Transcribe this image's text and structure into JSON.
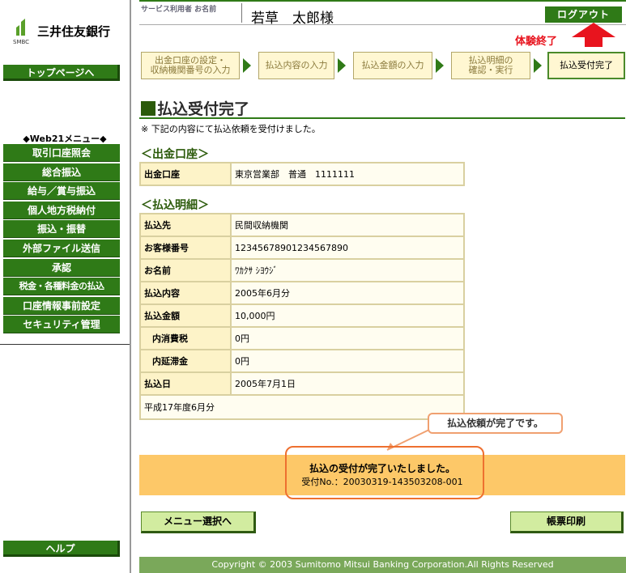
{
  "sidebar": {
    "brand_name": "三井住友銀行",
    "brand_sub": "SMBC",
    "top_page": "トップページへ",
    "menu_title": "◆Web21メニュー◆",
    "menu_items": [
      "取引口座照会",
      "総合振込",
      "給与／賞与振込",
      "個人地方税納付",
      "振込・振替",
      "外部ファイル送信",
      "承認",
      "税金・各種料金の払込",
      "口座情報事前設定",
      "セキュリティ管理"
    ],
    "help": "ヘルプ"
  },
  "header": {
    "user_label": "サービス利用者 お名前",
    "user_name": "若草　太郎様",
    "logout": "ログアウト",
    "end_label": "体験終了"
  },
  "steps": [
    {
      "line1": "出金口座の設定・",
      "line2": "収納機関番号の入力"
    },
    {
      "line1": "払込内容の入力",
      "line2": ""
    },
    {
      "line1": "払込金額の入力",
      "line2": ""
    },
    {
      "line1": "払込明細の",
      "line2": "確認・実行"
    },
    {
      "line1": "払込受付完了",
      "line2": ""
    }
  ],
  "page": {
    "title": "払込受付完了",
    "note": "※ 下記の内容にて払込依頼を受付けました。"
  },
  "account_section": {
    "heading": "＜出金口座＞",
    "label": "出金口座",
    "value": "東京営業部　普通　1111111"
  },
  "details_section": {
    "heading": "＜払込明細＞",
    "rows": [
      {
        "label": "払込先",
        "value": "民間収納機関"
      },
      {
        "label": "お客様番号",
        "value": "12345678901234567890"
      },
      {
        "label": "お名前",
        "value": "ﾜｶｸｻ ｼﾖｳｼﾞ"
      },
      {
        "label": "払込内容",
        "value": "2005年6月分"
      },
      {
        "label": "払込金額",
        "value": "10,000円"
      },
      {
        "label": "内消費税",
        "value": "0円"
      },
      {
        "label": "内延滞金",
        "value": "0円"
      },
      {
        "label": "払込日",
        "value": "2005年7月1日"
      }
    ],
    "memo": "平成17年度6月分"
  },
  "callout": "払込依頼が完了です。",
  "banner": {
    "main": "払込の受付が完了いたしました。",
    "receipt": "受付No.：20030319-143503208-001"
  },
  "actions": {
    "menu": "メニュー選択へ",
    "print": "帳票印刷"
  },
  "footer": "Copyright © 2003 Sumitomo Mitsui Banking Corporation.All Rights Reserved",
  "colors": {
    "accent_green": "#2f7a17",
    "banner_orange": "#fdc868",
    "alert_red": "#e8141e"
  }
}
